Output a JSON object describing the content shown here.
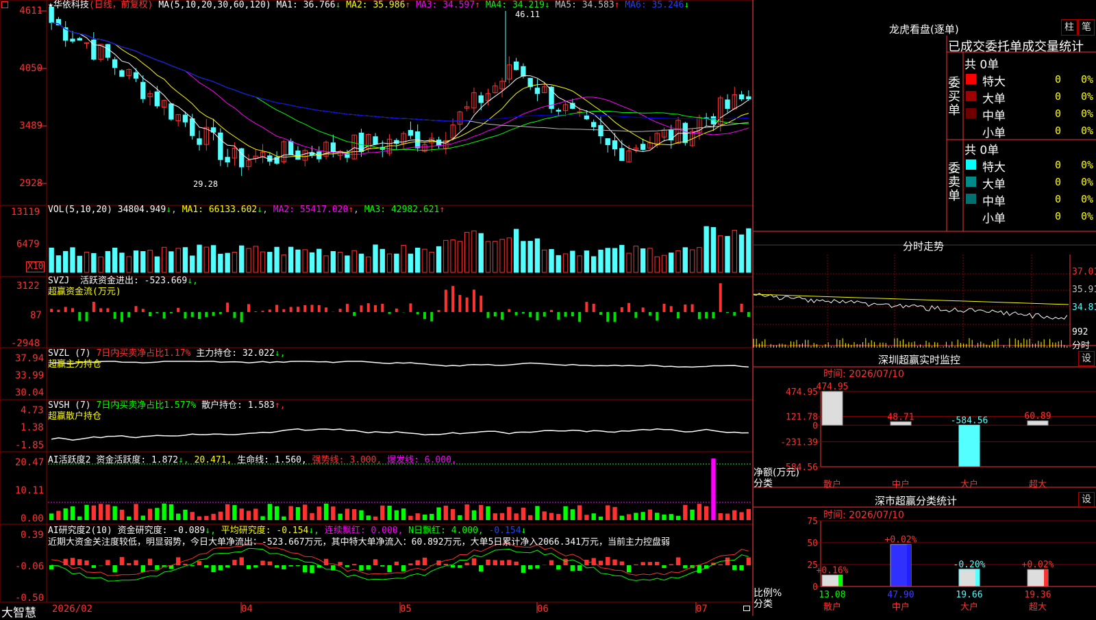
{
  "colors": {
    "up": "#ff3232",
    "down": "#54ffff",
    "grid": "#8b0000",
    "axis": "#ff3232",
    "ma1": "#ffffff",
    "ma2": "#ffff00",
    "ma3": "#ff00ff",
    "ma4": "#00ff00",
    "ma5": "#c0c0c0",
    "ma6": "#0000ff"
  },
  "main": {
    "stock_name": "华依科技",
    "period": "(日线，前复权)",
    "ma_caption": "MA(5,10,20,30,60,120)",
    "ma": [
      {
        "label": "MA1:",
        "value": "36.766",
        "arrow": "↓"
      },
      {
        "label": "MA2:",
        "value": "35.986",
        "arrow": "↑"
      },
      {
        "label": "MA3:",
        "value": "34.597",
        "arrow": "↑"
      },
      {
        "label": "MA4:",
        "value": "34.219",
        "arrow": "↓"
      },
      {
        "label": "MA5:",
        "value": "34.583",
        "arrow": "↑"
      },
      {
        "label": "MA6:",
        "value": "35.246",
        "arrow": "↓"
      }
    ],
    "y_ticks": [
      "4611",
      "4050",
      "3489",
      "2928"
    ],
    "high_label": "46.11",
    "low_label": "29.28"
  },
  "vol": {
    "caption": "VOL(5,10,20)",
    "value": "34804.949",
    "value_arrow": "↓",
    "ma1": "MA1: 66133.602",
    "ma1_arrow": "↓",
    "ma2": "MA2: 55417.020",
    "ma2_arrow": "↑",
    "ma3": "MA3: 42982.621",
    "ma3_arrow": "↑",
    "y_ticks": [
      "13119",
      "6479"
    ],
    "unit": "X10"
  },
  "svzj": {
    "caption": "SVZJ",
    "line1_label": "活跃资金进出:",
    "line1_value": "-523.669",
    "line1_arrow": "↓,",
    "line2": "超赢资金流(万元)",
    "y_ticks": [
      "3122",
      "87",
      "-2948"
    ]
  },
  "svzl": {
    "caption": "SVZL (7)",
    "ratio": "7日内买卖净占比1.17%",
    "hold": "主力持仓: 32.022",
    "hold_arrow": "↓,",
    "line2": "超赢主力持仓",
    "y_ticks": [
      "37.94",
      "33.99",
      "30.04"
    ]
  },
  "svsh": {
    "caption": "SVSH (7)",
    "ratio": "7日内买卖净占比1.577%",
    "hold": "散户持仓: 1.583",
    "hold_arrow": "↑,",
    "line2": "超赢散户持仓",
    "y_ticks": [
      "4.73",
      "1.38",
      "-1.85"
    ]
  },
  "ai1": {
    "caption": "AI活跃度2",
    "a": "资金活跃度: 1.872",
    "a_arrow": "↓,",
    "b": "20.471,",
    "c": "生命线: 1.560,",
    "d": "强势线: 3.000,",
    "e": "爆发线: 6.000,",
    "y_ticks": [
      "20.47",
      "10.11",
      "0.00"
    ]
  },
  "ai2": {
    "caption": "AI研究度2(10)",
    "a": "资金研究度: -0.089",
    "a_arrow": "↓,",
    "b": "平均研究度: -0.154",
    "b_arrow": "↓,",
    "c": "连续飘红: 0.000,",
    "d": "N日飘红: 4.000,",
    "e": "-0.154",
    "e_arrow": "↓",
    "text": "近期大资金关注度较低，明显弱势，今日大单净流出：-523.667万元，其中特大单净流入：60.892万元，大单5日累计净入2066.341万元，当前主力控盘弱",
    "y_ticks": [
      "0.39",
      "-0.06",
      "-0.50"
    ]
  },
  "footer": {
    "brand": "大智慧",
    "dates": [
      "2026/02",
      "04",
      "05",
      "06",
      "07"
    ]
  },
  "lhb": {
    "title": "龙虎看盘(逐单)",
    "btn_bar": "柱",
    "btn_pen": "笔",
    "header": "已成交委托单成交量统计",
    "buy": {
      "side": "委买单",
      "total": "共 0单",
      "rows": [
        {
          "name": "特大",
          "count": "0",
          "pct": "0%",
          "color": "#ff0000"
        },
        {
          "name": "大单",
          "count": "0",
          "pct": "0%",
          "color": "#a00000"
        },
        {
          "name": "中单",
          "count": "0",
          "pct": "0%",
          "color": "#700000"
        },
        {
          "name": "小单",
          "count": "0",
          "pct": "0%",
          "color": "#000000"
        }
      ]
    },
    "sell": {
      "side": "委卖单",
      "total": "共 0单",
      "rows": [
        {
          "name": "特大",
          "count": "0",
          "pct": "0%",
          "color": "#00ffff"
        },
        {
          "name": "大单",
          "count": "0",
          "pct": "0%",
          "color": "#008b8b"
        },
        {
          "name": "中单",
          "count": "0",
          "pct": "0%",
          "color": "#007070"
        },
        {
          "name": "小单",
          "count": "0",
          "pct": "0%",
          "color": "#000000"
        }
      ]
    }
  },
  "fenshi": {
    "title": "分时走势",
    "y_ticks": [
      "37.01",
      "35.91",
      "34.81",
      "992",
      "分时"
    ]
  },
  "monitor": {
    "title": "深圳超赢实时监控",
    "btn": "设",
    "time": "时间: 2026/07/10",
    "y_ticks": [
      "474.95",
      "121.78",
      "0",
      "-231.39",
      "-584.56"
    ],
    "ylabel": "净额(万元)",
    "xlabel": "分类"
  },
  "classify": {
    "title": "深市超赢分类统计",
    "btn": "设",
    "time": "时间: 2026/07/10",
    "y_ticks": [
      "75",
      "50",
      "25",
      "0"
    ],
    "ylabel": "比例%",
    "xlabel": "分类"
  },
  "chart_data": [
    {
      "type": "bar",
      "title": "深圳超赢实时监控",
      "categories": [
        "散户",
        "中户",
        "大户",
        "超大"
      ],
      "values": [
        474.95,
        48.71,
        -584.56,
        60.89
      ],
      "ylim": [
        -584.56,
        474.95
      ],
      "ylabel": "净额(万元)",
      "xlabel": "分类"
    },
    {
      "type": "bar",
      "title": "深市超赢分类统计",
      "categories": [
        "散户",
        "中户",
        "大户",
        "超大"
      ],
      "values": [
        13.08,
        47.9,
        19.66,
        19.36
      ],
      "labels": [
        "+0.16%",
        "+0.02%",
        "-0.20%",
        "+0.02%"
      ],
      "ylim": [
        0,
        75
      ],
      "ylabel": "比例%",
      "xlabel": "分类"
    }
  ]
}
